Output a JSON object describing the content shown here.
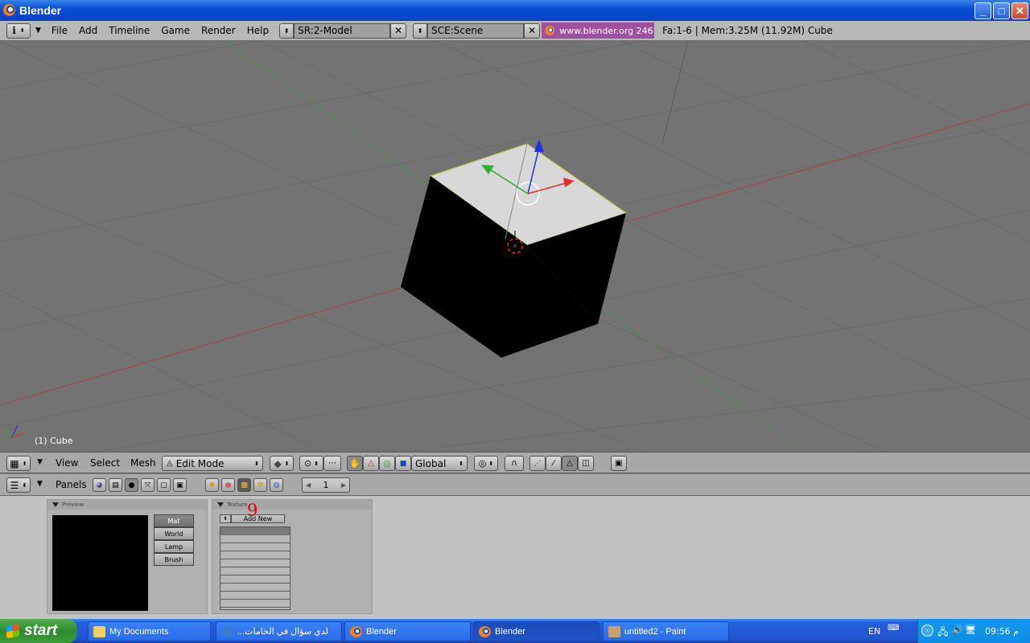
{
  "window": {
    "title": "Blender",
    "minimize": "_",
    "maximize": "□",
    "close": "✕"
  },
  "menubar": {
    "items": [
      "File",
      "Add",
      "Timeline",
      "Game",
      "Render",
      "Help"
    ],
    "screen_field": "SR:2-Model",
    "scene_field": "SCE:Scene",
    "url": "www.blender.org 246",
    "info": "Fa:1-6 | Mem:3.25M (11.92M) Cube"
  },
  "viewport": {
    "object_label": "(1) Cube",
    "accent_red": "#e03030",
    "accent_green": "#30b030",
    "accent_blue": "#2030e0"
  },
  "viewport_header": {
    "items": [
      "View",
      "Select",
      "Mesh"
    ],
    "mode": "Edit Mode",
    "orientation": "Global"
  },
  "buttons_header": {
    "panels_label": "Panels",
    "frame": "1"
  },
  "preview_panel": {
    "title": "Preview",
    "tabs": [
      "Mat",
      "World",
      "Lamp",
      "Brush"
    ]
  },
  "texture_panel": {
    "title": "Texture",
    "add_new": "Add New",
    "annotation": "9"
  },
  "taskbar": {
    "start": "start",
    "tasks": [
      "My Documents",
      "لدي سؤال في الخامات...",
      "Blender",
      "Blender",
      "untitled2 - Paint"
    ],
    "lang": "EN",
    "clock": "09:56 م"
  }
}
